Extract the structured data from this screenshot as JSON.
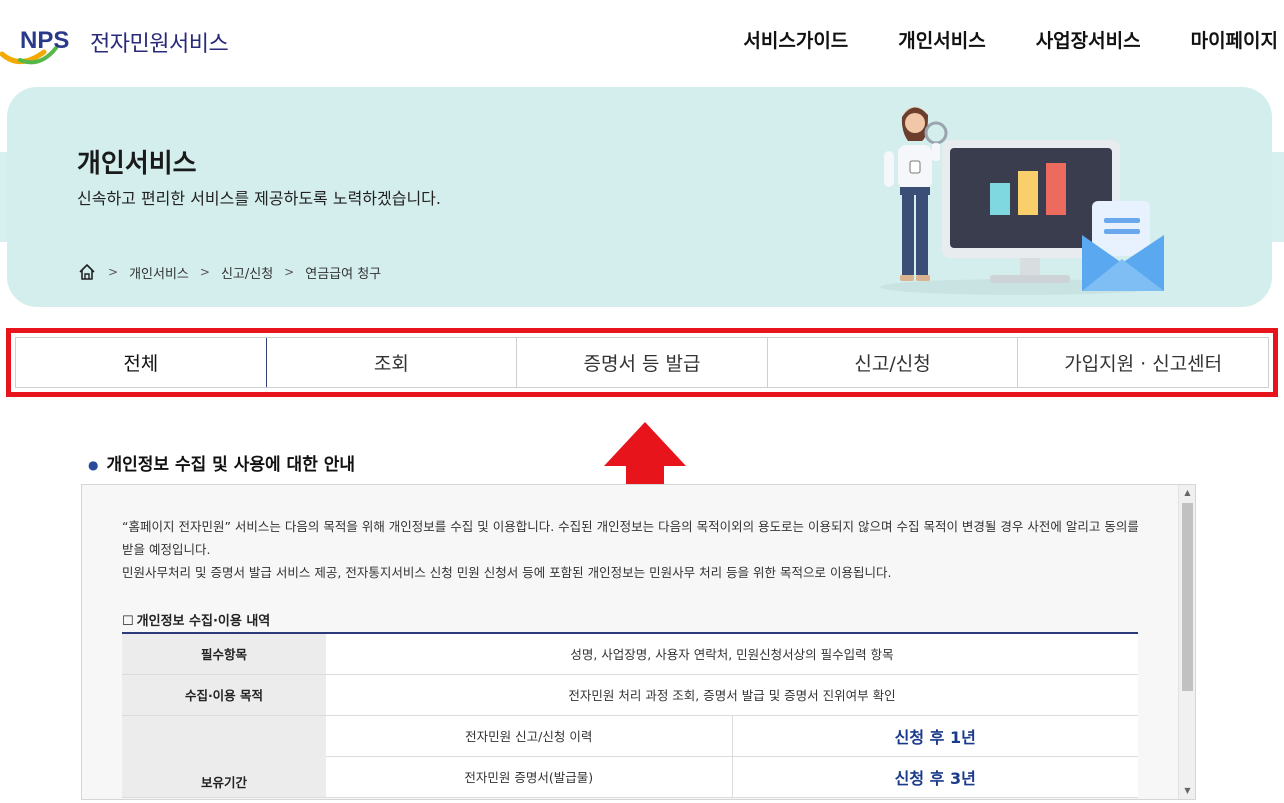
{
  "header": {
    "logo_text": "전자민원서비스",
    "logo_mark_label": "NPS",
    "nav": [
      "서비스가이드",
      "개인서비스",
      "사업장서비스",
      "마이페이지"
    ]
  },
  "banner": {
    "title": "개인서비스",
    "description": "신속하고 편리한 서비스를 제공하도록 노력하겠습니다.",
    "breadcrumb": [
      "개인서비스",
      "신고/신청",
      "연금급여 청구"
    ],
    "breadcrumb_sep": ">"
  },
  "tabs": [
    {
      "label": "전체"
    },
    {
      "label": "조회"
    },
    {
      "label": "증명서 등 발급"
    },
    {
      "label": "신고/신청"
    },
    {
      "label": "가입지원 · 신고센터"
    }
  ],
  "section": {
    "title": "개인정보 수집 및 사용에 대한 안내",
    "para1": "“홈페이지 전자민원” 서비스는 다음의 목적을 위해 개인정보를 수집 및 이용합니다. 수집된 개인정보는 다음의 목적이외의 용도로는 이용되지 않으며 수집 목적이 변경될 경우 사전에 알리고 동의를 받을 예정입니다.",
    "para2": "민원사무처리 및 증명서 발급 서비스 제공, 전자통지서비스 신청 민원 신청서 등에 포함된 개인정보는 민원사무 처리 등을 위한 목적으로 이용됩니다.",
    "sub_title": "개인정보 수집·이용 내역",
    "sub_title_box": "☐",
    "table": {
      "required_label": "필수항목",
      "required_value": "성명, 사업장명, 사용자 연락처, 민원신청서상의 필수입력 항목",
      "purpose_label": "수집·이용 목적",
      "purpose_value": "전자민원 처리 과정 조회, 증명서 발급 및 증명서 진위여부 확인",
      "retention_label": "보유기간",
      "retention_rows": [
        {
          "item": "전자민원 신고/신청 이력",
          "period": "신청 후 1년"
        },
        {
          "item": "전자민원 증명서(발급물)",
          "period": "신청 후 3년"
        }
      ]
    }
  },
  "colors": {
    "banner_bg": "#d4eeee",
    "highlight_red": "#e8141c",
    "accent_navy": "#1a3a8a"
  }
}
